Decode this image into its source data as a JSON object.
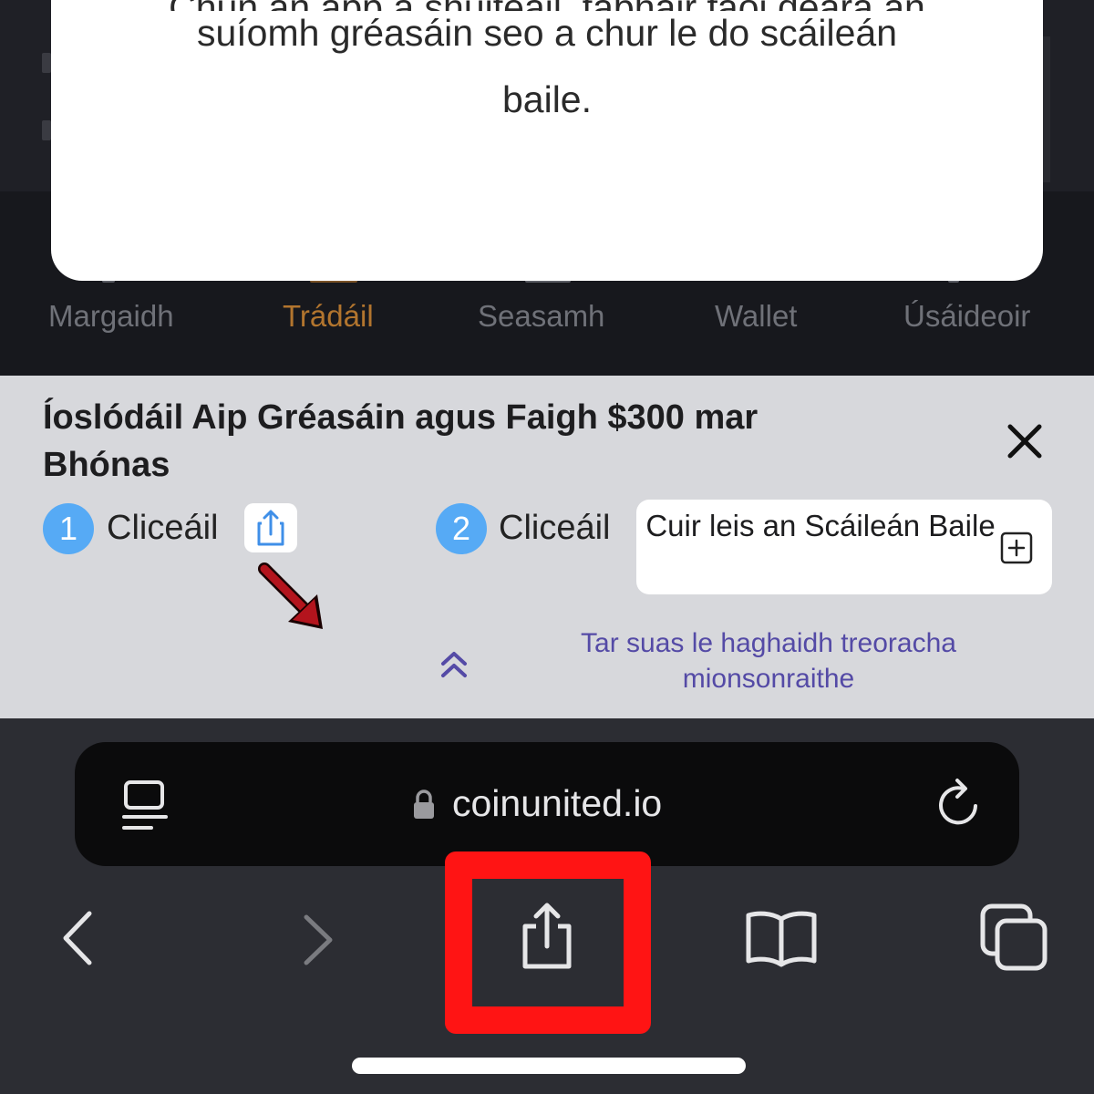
{
  "modal": {
    "line_cut": "Chun an app a shuiteáil, tabhair faoi deara an",
    "line1": "suíomh gréasáin seo a chur le do scáileán",
    "line2": "baile."
  },
  "app_nav": {
    "tabs": [
      "Margaidh",
      "Trádáil",
      "Seasamh",
      "Wallet",
      "Úsáideoir"
    ],
    "active": "Trádáil"
  },
  "banner": {
    "title": "Íoslódáil Aip Gréasáin agus Faigh $300 mar Bhónas",
    "step1": {
      "number": "1",
      "label": "Cliceáil",
      "icon": "share-icon"
    },
    "step2": {
      "number": "2",
      "label": "Cliceáil",
      "button_label": "Cuir leis an Scáileán Baile",
      "icon": "plus-square-icon"
    },
    "hint": "Tar suas le haghaidh treoracha mionsonraithe",
    "hint_icon": "double-chevron-up-icon",
    "close_icon": "close-icon"
  },
  "browser": {
    "url": "coinunited.io",
    "lock_icon": "lock-icon",
    "reader_icon": "reader-mode-icon",
    "reload_icon": "reload-icon",
    "toolbar": [
      "back-icon",
      "forward-icon",
      "share-icon",
      "bookmarks-icon",
      "tabs-icon"
    ]
  },
  "colors": {
    "accent_active_tab": "#b2752e",
    "step_badge": "#56aaf5",
    "hint_link": "#544aa6",
    "highlight": "#ff1414",
    "pointer_arrow": "#b3141d"
  }
}
